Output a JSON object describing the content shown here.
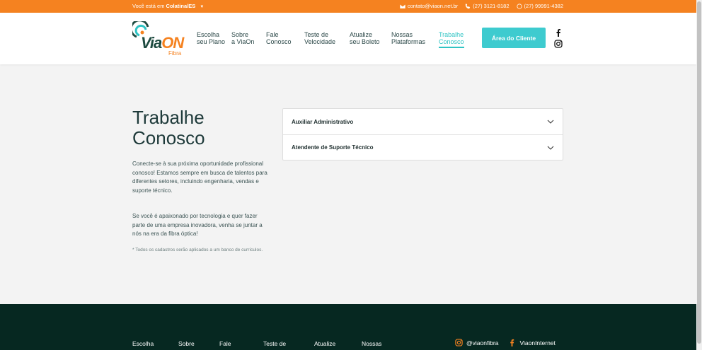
{
  "topbar": {
    "location_prefix": "Você está em",
    "location_city": "Colatina/ES",
    "email": "contato@viaon.net.br",
    "phone": "(27) 3121-8182",
    "whatsapp": "(27) 99991-4382"
  },
  "logo": {
    "via": "Via",
    "on": "ON",
    "sub": "Fibra"
  },
  "nav": [
    {
      "line1": "Escolha",
      "line2": "seu Plano"
    },
    {
      "line1": "Sobre",
      "line2": "a ViaOn"
    },
    {
      "line1": "Fale",
      "line2": "Conosco"
    },
    {
      "line1": "Teste de",
      "line2": "Velocidade"
    },
    {
      "line1": "Atualize",
      "line2": "seu Boleto"
    },
    {
      "line1": "Nossas",
      "line2": "Plataformas"
    },
    {
      "line1": "Trabalhe",
      "line2": "Conosco"
    }
  ],
  "client_button": "Área do Cliente",
  "main": {
    "title_line1": "Trabalhe",
    "title_line2": "Conosco",
    "paragraph1": "Conecte-se à sua próxima oportunidade profissional conosco! Estamos sempre em busca de talentos para diferentes setores, incluindo engenharia, vendas e suporte técnico.",
    "paragraph2": "Se você é apaixonado por tecnologia e quer fazer parte de uma empresa inovadora, venha se juntar a nós na era da fibra óptica!",
    "note": "* Todos os cadastros serão aplicados a um banco de currículos."
  },
  "jobs": [
    "Auxiliar Administrativo",
    "Atendente de Suporte Técnico"
  ],
  "footer": {
    "nav": [
      "Escolha",
      "Sobre",
      "Fale",
      "Teste de",
      "Atualize",
      "Nossas"
    ],
    "instagram": "@viaonfibra",
    "facebook": "ViaonInternet"
  },
  "colors": {
    "accent_orange": "#f58220",
    "accent_teal": "#3ecbcf",
    "footer_bg": "#062821"
  }
}
